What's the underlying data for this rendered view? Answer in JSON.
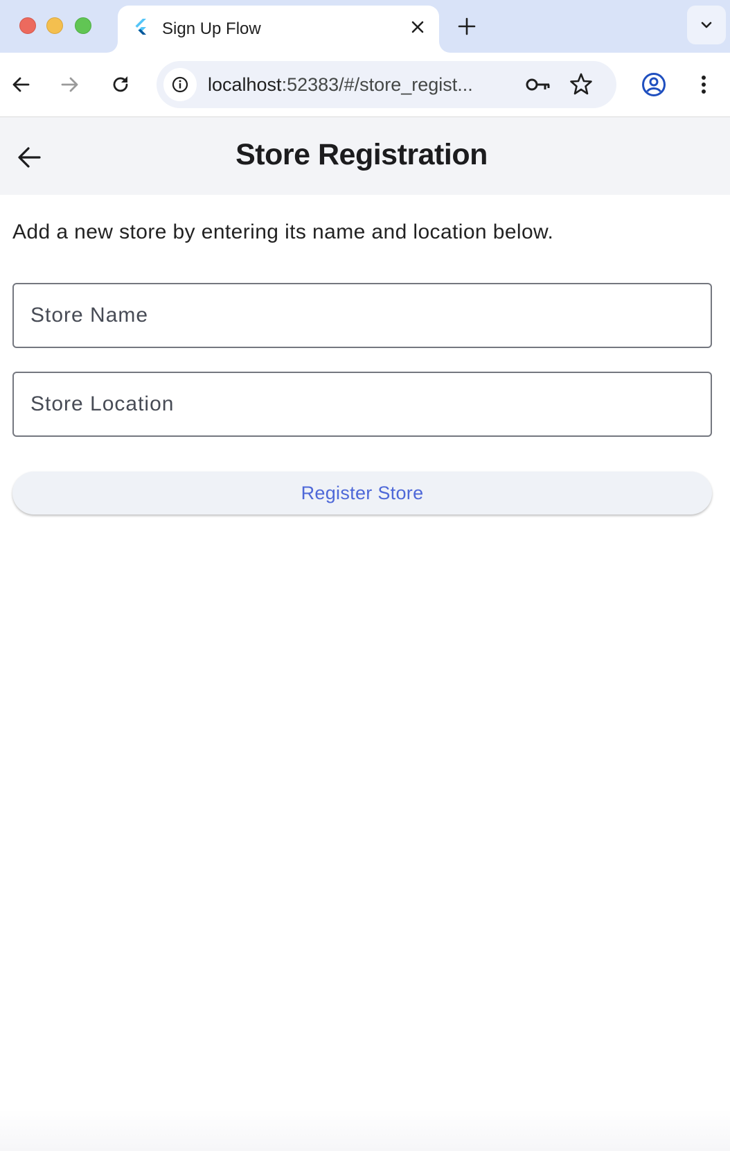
{
  "browser": {
    "tab": {
      "title": "Sign Up Flow",
      "favicon": "flutter-logo-icon"
    },
    "address_bar": {
      "url_host": "localhost",
      "url_rest": ":52383/#/store_regist..."
    },
    "icons": {
      "back": "arrow-left-icon",
      "forward": "arrow-right-icon",
      "reload": "reload-icon",
      "site_info": "info-icon",
      "password": "key-icon",
      "bookmark": "star-icon",
      "profile": "account-circle-icon",
      "menu": "more-vert-icon",
      "new_tab": "plus-icon",
      "tab_search": "chevron-down-icon"
    },
    "colors": {
      "tabstrip": "#d9e3f8",
      "omnibox": "#eef1f9",
      "profile_accent": "#1f4fbf"
    }
  },
  "page": {
    "appbar": {
      "title": "Store Registration",
      "back_icon": "arrow-left-icon"
    },
    "intro_text": "Add a new store by entering its name and location below.",
    "form": {
      "store_name": {
        "value": "",
        "placeholder": "Store Name"
      },
      "store_location": {
        "value": "",
        "placeholder": "Store Location"
      },
      "submit_label": "Register Store"
    },
    "colors": {
      "appbar_bg": "#f3f4f7",
      "button_bg": "#eff2f7",
      "button_text": "#4e68d8",
      "field_border": "#74777f"
    }
  }
}
